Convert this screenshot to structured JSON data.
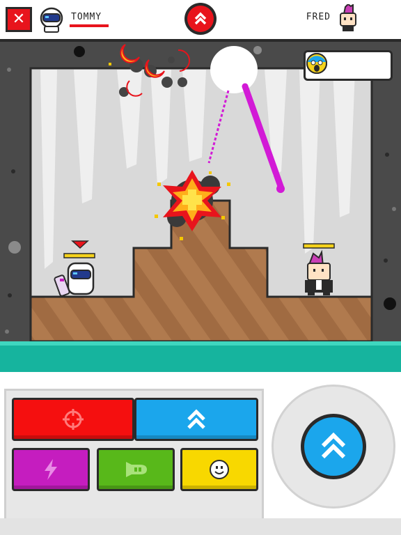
{
  "hud": {
    "close_icon": "close-x-icon",
    "player1": {
      "name": "TOMMY",
      "avatar": "astronaut-avatar",
      "health_fraction": 1.0,
      "health_color": "#e8141c"
    },
    "player2": {
      "name": "FRED",
      "avatar": "punk-mohawk-avatar"
    },
    "turn_indicator_icon": "double-chevron-up-icon",
    "turn_indicator_color": "#e8141c"
  },
  "scene": {
    "reactions": [
      "scared-face-emoji",
      "scared-face-emoji",
      "scared-face-emoji"
    ],
    "player1_health_fraction": 1.0,
    "player2_health_fraction": 1.0,
    "active_player_marker": "red-down-arrow",
    "colors": {
      "cave_wall": "#4a4a4a",
      "cave_bg": "#d9d9d9",
      "dirt": "#b07a4e",
      "water": "#16b49e",
      "laser": "#d21ad6"
    }
  },
  "controls": {
    "weapons": [
      {
        "id": "aim",
        "icon": "crosshair-icon",
        "color": "#f50f0f",
        "selected": true
      },
      {
        "id": "jump",
        "icon": "double-chevron-up-icon",
        "color": "#1ba6ec",
        "selected": false
      },
      {
        "id": "lightning",
        "icon": "lightning-icon",
        "color": "#c51dbf",
        "selected": false
      },
      {
        "id": "rocket",
        "icon": "rocket-icon",
        "color": "#58b81a",
        "selected": false
      },
      {
        "id": "emote",
        "icon": "smiley-icon",
        "color": "#f8d800",
        "selected": false
      }
    ],
    "fire_button_icon": "double-chevron-up-icon",
    "fire_button_color": "#1ba6ec"
  }
}
